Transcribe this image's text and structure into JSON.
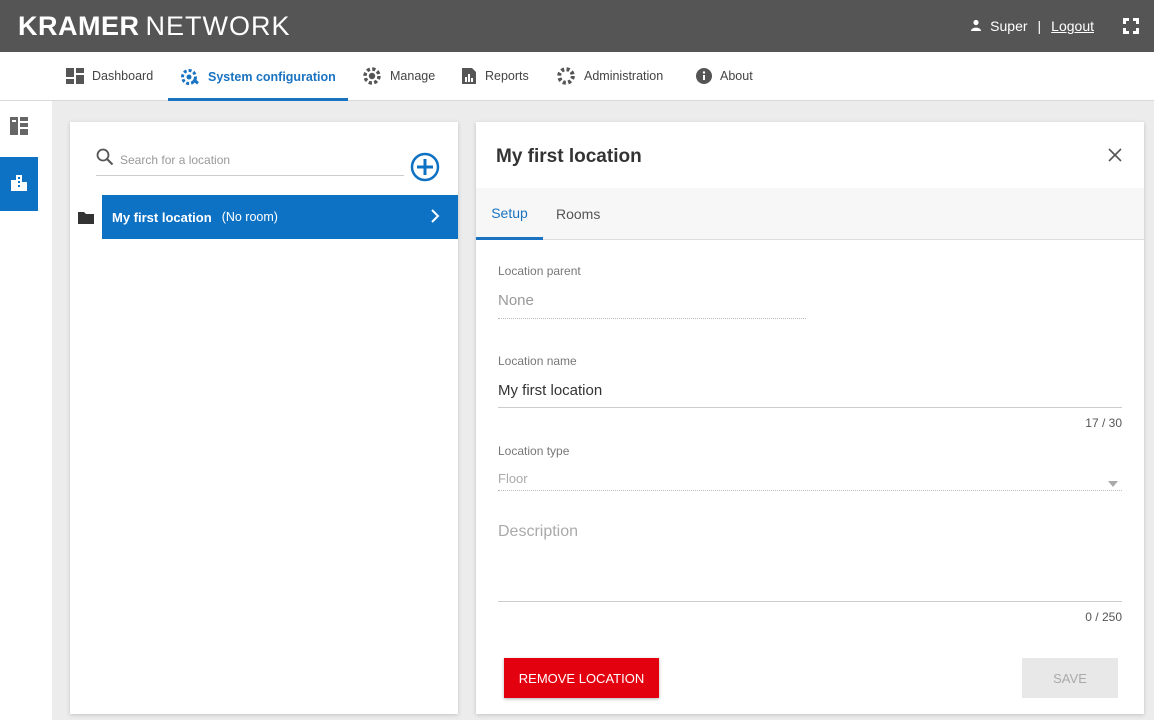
{
  "brand": {
    "bold": "KRAMER",
    "light": "NETWORK"
  },
  "user": {
    "name": "Super",
    "separator": "|",
    "logout": "Logout"
  },
  "nav": {
    "dashboard": "Dashboard",
    "system_configuration": "System configuration",
    "manage": "Manage",
    "reports": "Reports",
    "administration": "Administration",
    "about": "About"
  },
  "locations_panel": {
    "search_placeholder": "Search for a location",
    "items": [
      {
        "name": "My first location",
        "rooms": "(No room)"
      }
    ]
  },
  "detail": {
    "title": "My first location",
    "tabs": {
      "setup": "Setup",
      "rooms": "Rooms"
    },
    "location_parent_label": "Location parent",
    "location_parent_value": "None",
    "location_name_label": "Location name",
    "location_name_value": "My first location",
    "location_name_counter": "17 / 30",
    "location_type_label": "Location type",
    "location_type_value": "Floor",
    "description_placeholder": "Description",
    "description_counter": "0 / 250",
    "remove_label": "REMOVE LOCATION",
    "save_label": "SAVE"
  },
  "colors": {
    "accent": "#1a73c1",
    "selected_row": "#0e72c4",
    "danger": "#e3000f",
    "topbar": "#555555"
  }
}
